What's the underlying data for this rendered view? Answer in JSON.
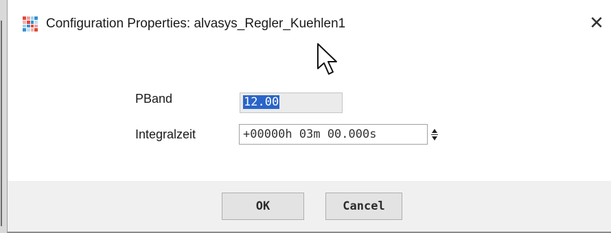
{
  "window": {
    "title": "Configuration Properties: alvasys_Regler_Kuehlen1",
    "close_glyph": "✕"
  },
  "fields": {
    "pband": {
      "label": "PBand",
      "value": "12.00"
    },
    "integralzeit": {
      "label": "Integralzeit",
      "value": "+00000h 03m 00.000s"
    }
  },
  "buttons": {
    "ok": "OK",
    "cancel": "Cancel"
  },
  "colors": {
    "selection": "#2a64c8",
    "footer_bg": "#f0f0f0",
    "button_bg": "#e3e3e3"
  },
  "icons": {
    "app": "app-grid-icon",
    "close": "close-icon",
    "spinner": "spinner-icon",
    "pointer": "mouse-pointer-icon"
  }
}
